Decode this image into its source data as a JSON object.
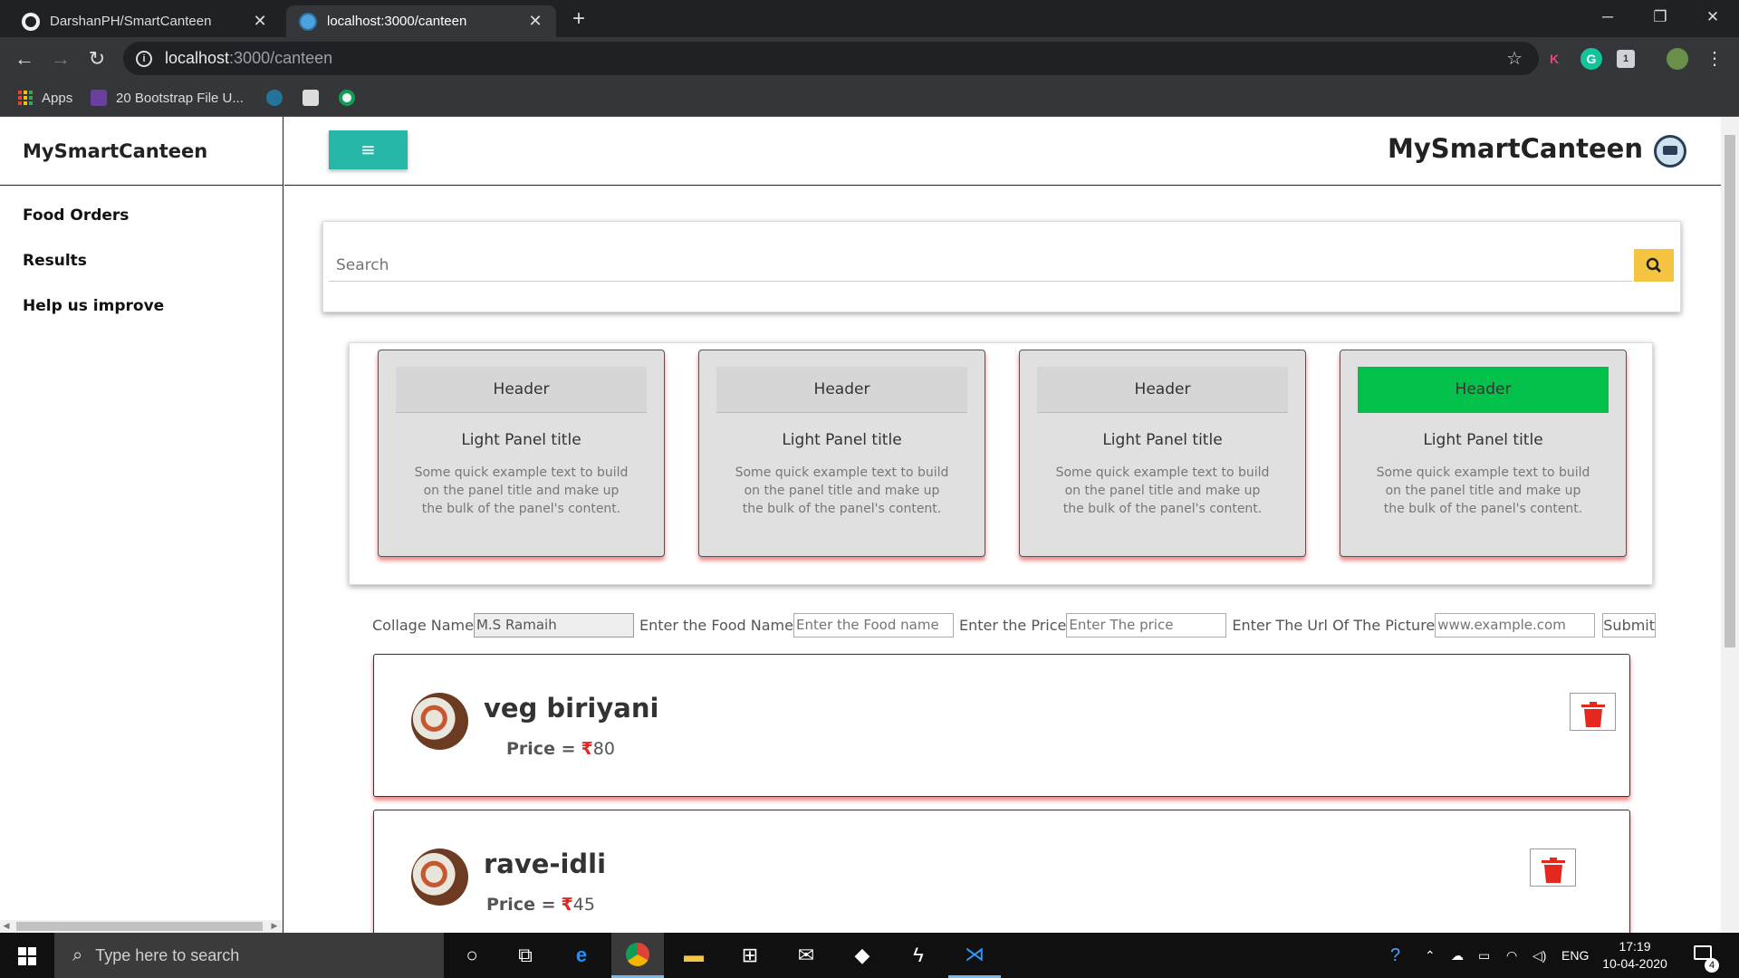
{
  "browser": {
    "tabs": [
      {
        "title": "DarshanPH/SmartCanteen",
        "active": false
      },
      {
        "title": "localhost:3000/canteen",
        "active": true
      }
    ],
    "url_host": "localhost",
    "url_path": ":3000/canteen",
    "bookmarks": [
      {
        "label": "Apps"
      },
      {
        "label": "20 Bootstrap File U..."
      }
    ]
  },
  "sidebar": {
    "brand": "MySmartCanteen",
    "items": [
      {
        "label": "Food Orders"
      },
      {
        "label": "Results"
      },
      {
        "label": "Help us improve"
      }
    ]
  },
  "topbar": {
    "menu_icon": "≡",
    "brand": "MySmartCanteen"
  },
  "search": {
    "placeholder": "Search"
  },
  "panels": [
    {
      "header": "Header",
      "title": "Light Panel title",
      "text": "Some quick example text to build on the panel title and make up the bulk of the panel's content.",
      "header_color": "#d6d6d6"
    },
    {
      "header": "Header",
      "title": "Light Panel title",
      "text": "Some quick example text to build on the panel title and make up the bulk of the panel's content.",
      "header_color": "#d6d6d6"
    },
    {
      "header": "Header",
      "title": "Light Panel title",
      "text": "Some quick example text to build on the panel title and make up the bulk of the panel's content.",
      "header_color": "#d6d6d6"
    },
    {
      "header": "Header",
      "title": "Light Panel title",
      "text": "Some quick example text to build on the panel title and make up the bulk of the panel's content.",
      "header_color": "#03c04a"
    }
  ],
  "form": {
    "college_label": "Collage Name",
    "college_value": "M.S Ramaih",
    "food_label": "Enter the Food Name",
    "food_placeholder": "Enter the Food name",
    "price_label": "Enter the Price",
    "price_placeholder": "Enter The price",
    "url_label": "Enter The Url Of The Picture",
    "url_placeholder": "www.example.com",
    "submit_label": "Submit"
  },
  "foods": [
    {
      "name": "veg biriyani",
      "price_label": "Price =",
      "currency": "₹",
      "price": "80"
    },
    {
      "name": "rave-idli",
      "price_label": "Price =",
      "currency": "₹",
      "price": "45"
    }
  ],
  "taskbar": {
    "search_placeholder": "Type here to search",
    "language": "ENG",
    "time": "17:19",
    "date": "10-04-2020",
    "notification_count": "4"
  },
  "colors": {
    "accent_teal": "#26b7a6",
    "search_button": "#f5c541",
    "active_panel": "#03c04a",
    "delete_red": "#e5281f"
  }
}
